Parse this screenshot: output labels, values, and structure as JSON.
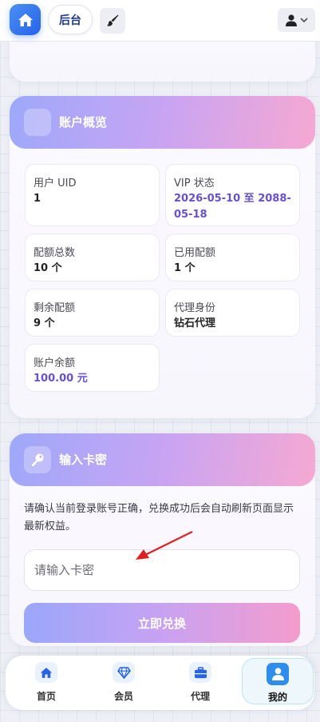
{
  "topbar": {
    "admin_label": "后台",
    "icons": [
      "home-icon",
      "brush-icon",
      "user-icon",
      "chevron-down-icon"
    ]
  },
  "account_overview": {
    "title": "账户概览",
    "stats": [
      {
        "label": "用户 UID",
        "value": "1"
      },
      {
        "label": "VIP 状态",
        "value": "2026-05-10 至 2088-05-18"
      },
      {
        "label": "配额总数",
        "value": "10 个"
      },
      {
        "label": "已用配额",
        "value": "1 个"
      },
      {
        "label": "剩余配额",
        "value": "9 个"
      },
      {
        "label": "代理身份",
        "value": "钻石代理"
      },
      {
        "label": "账户余额",
        "value": "100.00 元"
      }
    ]
  },
  "redeem": {
    "title": "输入卡密",
    "description": "请确认当前登录账号正确，兑换成功后会自动刷新页面显示最新权益。",
    "input_placeholder": "请输入卡密",
    "button_label": "立即兑换"
  },
  "bottom_nav": {
    "items": [
      {
        "label": "首页",
        "icon": "home-icon"
      },
      {
        "label": "会员",
        "icon": "diamond-icon"
      },
      {
        "label": "代理",
        "icon": "briefcase-icon"
      },
      {
        "label": "我的",
        "icon": "user-icon",
        "active": true
      }
    ]
  },
  "colors": {
    "accent_blue": "#2563eb",
    "header_gradient_start": "#9ea8fa",
    "header_gradient_end": "#f6a8d2",
    "value_purple": "#6a4ed8"
  }
}
